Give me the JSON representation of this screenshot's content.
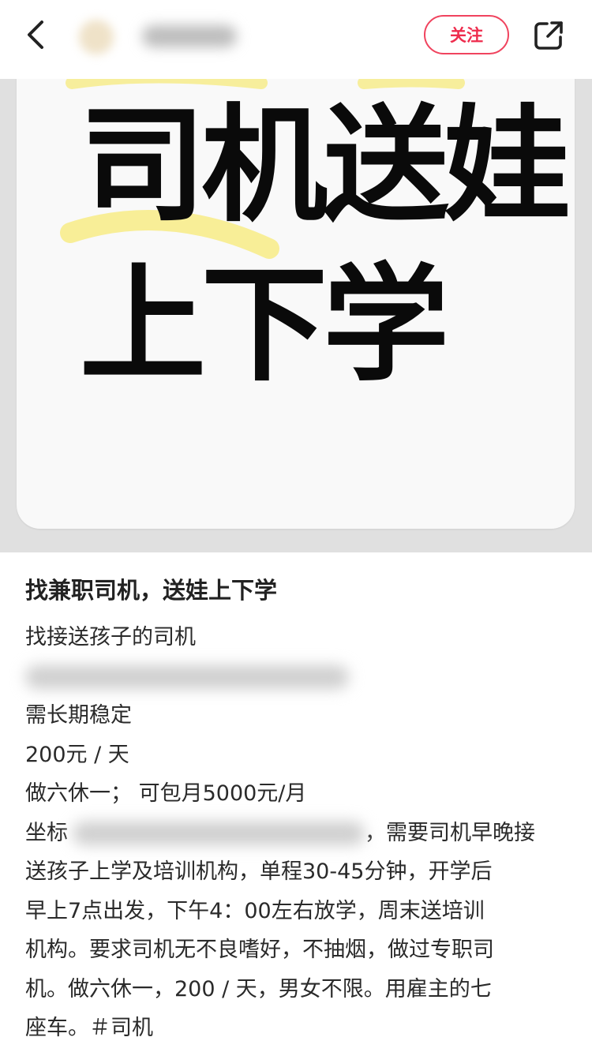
{
  "header": {
    "follow_label": "关注",
    "back_icon": "chevron-left-icon",
    "share_icon": "share-icon"
  },
  "image": {
    "line1": "司机送娃",
    "line2": "上下学",
    "highlight_color": "#f7ec8c"
  },
  "post": {
    "title": "找兼职司机，送娃上下学",
    "lines": [
      "找接送孩子的司机",
      "",
      "需长期稳定",
      "200元 / 天",
      "做六休一； 可包月5000元/月"
    ],
    "location_prefix": "坐标",
    "location_suffix": "，需要司机早晚接",
    "body_lines": [
      "送孩子上学及培训机构，单程30-45分钟，开学后",
      "早上7点出发，下午4：00左右放学，周末送培训",
      "机构。要求司机无不良嗜好，不抽烟，做过专职司",
      "机。做六休一，200 / 天，男女不限。用雇主的七"
    ],
    "last_line_text": "座车。",
    "hashtag": "＃司机"
  },
  "colors": {
    "accent": "#ee2c4d",
    "image_background": "#e0e0e0",
    "card_background": "#f9f9f9"
  }
}
